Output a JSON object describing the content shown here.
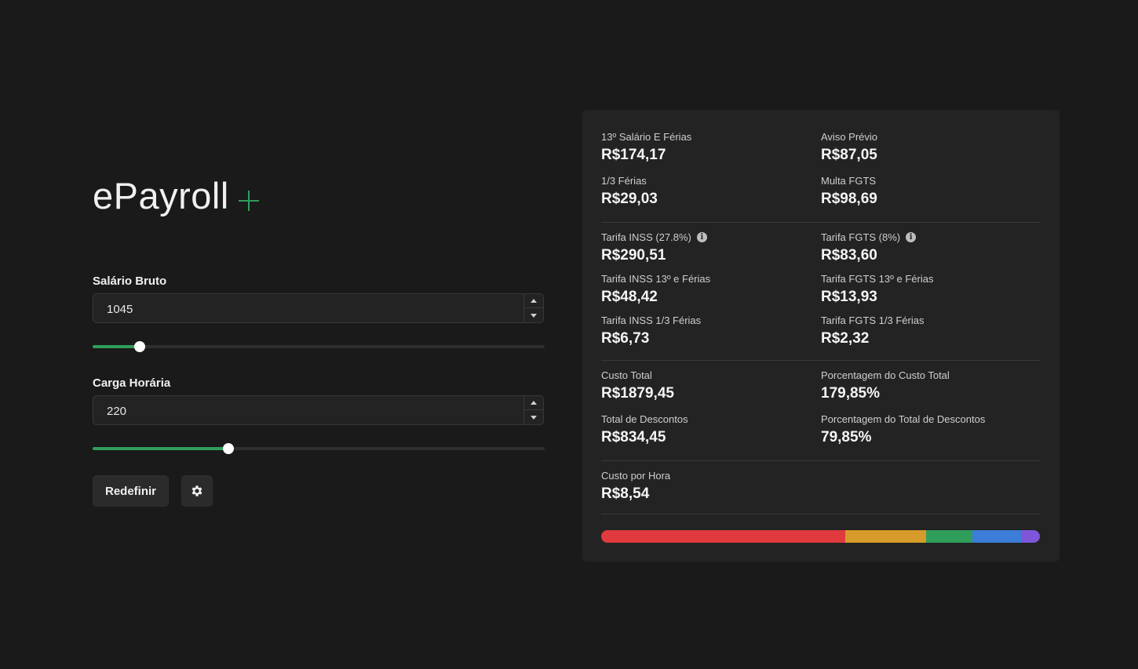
{
  "app": {
    "name": "ePayroll"
  },
  "form": {
    "salary_label": "Salário Bruto",
    "salary_value": "1045",
    "salary_slider_level": 0.104,
    "hours_label": "Carga Horária",
    "hours_value": "220",
    "hours_slider_level": 0.3,
    "reset_label": "Redefinir"
  },
  "results": {
    "decimo_ferias": {
      "label": "13º Salário E Férias",
      "value": "R$174,17"
    },
    "aviso_previo": {
      "label": "Aviso Prévio",
      "value": "R$87,05"
    },
    "um_terco_ferias": {
      "label": "1/3 Férias",
      "value": "R$29,03"
    },
    "multa_fgts": {
      "label": "Multa FGTS",
      "value": "R$98,69"
    },
    "tarifa_inss": {
      "label": "Tarifa INSS (27.8%)",
      "value": "R$290,51"
    },
    "tarifa_fgts": {
      "label": "Tarifa FGTS (8%)",
      "value": "R$83,60"
    },
    "tarifa_inss_13": {
      "label": "Tarifa INSS 13º e Férias",
      "value": "R$48,42"
    },
    "tarifa_fgts_13": {
      "label": "Tarifa FGTS 13º e Férias",
      "value": "R$13,93"
    },
    "tarifa_inss_terco": {
      "label": "Tarifa INSS 1/3 Férias",
      "value": "R$6,73"
    },
    "tarifa_fgts_terco": {
      "label": "Tarifa FGTS 1/3 Férias",
      "value": "R$2,32"
    },
    "custo_total": {
      "label": "Custo Total",
      "value": "R$1879,45"
    },
    "pct_custo_total": {
      "label": "Porcentagem do Custo Total",
      "value": "179,85%"
    },
    "total_descontos": {
      "label": "Total de Descontos",
      "value": "R$834,45"
    },
    "pct_total_descontos": {
      "label": "Porcentagem do Total de Descontos",
      "value": "79,85%"
    },
    "custo_hora": {
      "label": "Custo por Hora",
      "value": "R$8,54"
    }
  },
  "breakdown_bar": [
    {
      "color": "#e03a3e",
      "fraction": 0.557
    },
    {
      "color": "#d69b2a",
      "fraction": 0.184
    },
    {
      "color": "#2f9e5a",
      "fraction": 0.106
    },
    {
      "color": "#3b7dd8",
      "fraction": 0.11
    },
    {
      "color": "#7f56d9",
      "fraction": 0.043
    }
  ],
  "icons": {
    "info": "info-icon",
    "settings": "gear-icon",
    "brand": "plus-icon"
  },
  "colors": {
    "accent": "#2f9e5a",
    "background": "#1a1a1a",
    "panel": "#232323"
  }
}
